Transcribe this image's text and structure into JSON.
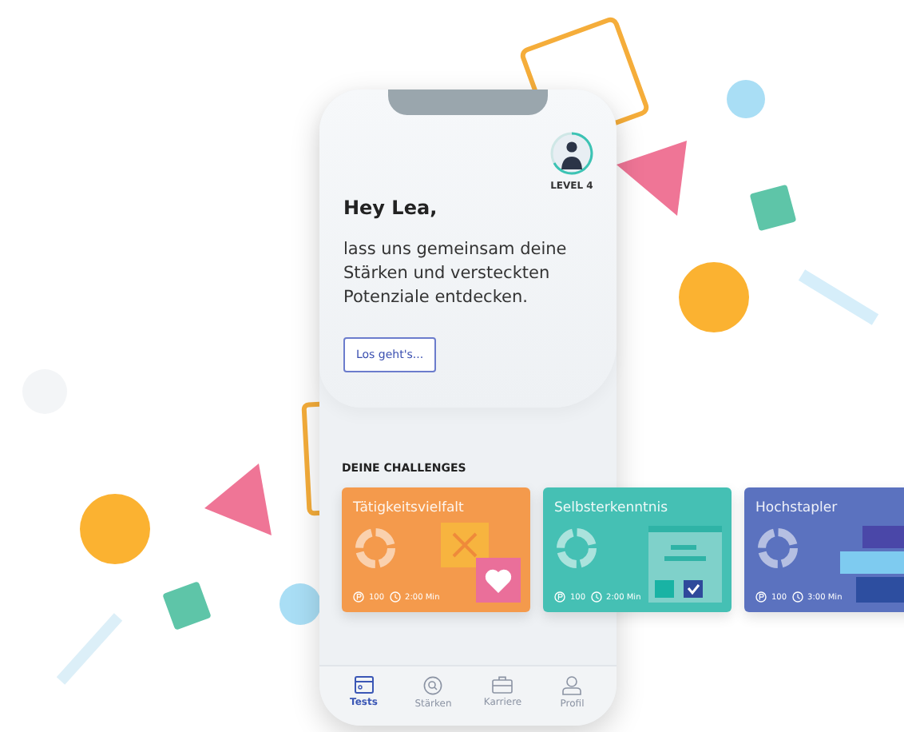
{
  "greeting": {
    "level": "LEVEL 4",
    "title": "Hey Lea,",
    "message": "lass uns gemeinsam deine Stärken und versteckten Potenziale entdecken.",
    "button": "Los geht's..."
  },
  "section_title": "DEINE CHALLENGES",
  "challenges": [
    {
      "title": "Tätigkeitsvielfalt",
      "points": "100",
      "duration": "2:00 Min",
      "color": "#f49a4c",
      "kind": "choice"
    },
    {
      "title": "Selbsterkenntnis",
      "points": "100",
      "duration": "2:00 Min",
      "color": "#45c0b4",
      "kind": "document"
    },
    {
      "title": "Hochstapler",
      "points": "100",
      "duration": "3:00 Min",
      "color": "#5b72bf",
      "kind": "blocks"
    }
  ],
  "nav": [
    {
      "label": "Tests",
      "selected": true,
      "kind": "tests"
    },
    {
      "label": "Stärken",
      "selected": false,
      "kind": "search"
    },
    {
      "label": "Karriere",
      "selected": false,
      "kind": "career"
    },
    {
      "label": "Profil",
      "selected": false,
      "kind": "profile"
    }
  ]
}
